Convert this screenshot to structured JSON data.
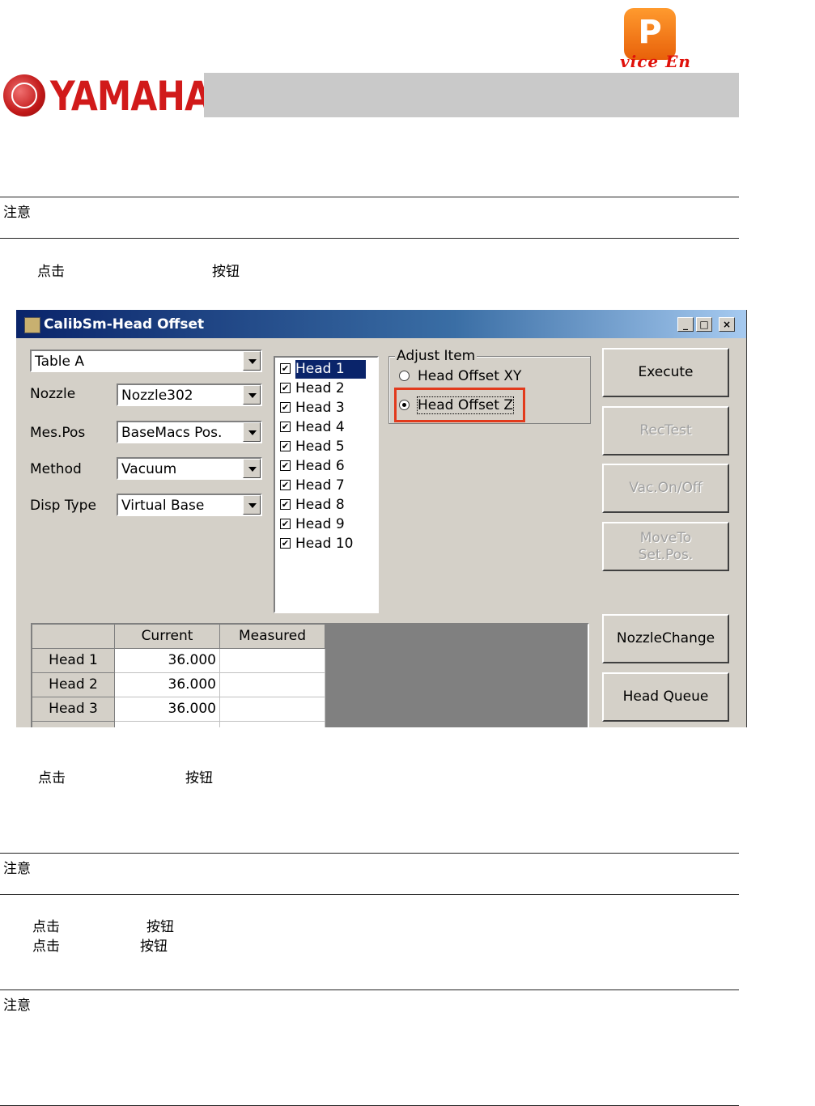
{
  "header": {
    "badge_letter": "P",
    "logo_text": "vice  En",
    "brand": "YAMAHA"
  },
  "doc": {
    "note1": "注意",
    "step1_a": "点击",
    "step1_b": "按钮",
    "step2_a": "点击",
    "step2_b": "按钮",
    "note2": "注意",
    "step3_a": "点击",
    "step3_b": "按钮",
    "step4_a": "点击",
    "step4_b": "按钮",
    "note3": "注意"
  },
  "window": {
    "title": "CalibSm-Head Offset",
    "caption_buttons": [
      "_",
      "□",
      "×"
    ],
    "table_select": "Table A",
    "fields": [
      {
        "label": "Nozzle",
        "value": "Nozzle302"
      },
      {
        "label": "Mes.Pos",
        "value": "BaseMacs Pos."
      },
      {
        "label": "Method",
        "value": "Vacuum"
      },
      {
        "label": "Disp Type",
        "value": "Virtual Base"
      }
    ],
    "heads": [
      {
        "label": "Head 1",
        "checked": true,
        "selected": true
      },
      {
        "label": "Head 2",
        "checked": true
      },
      {
        "label": "Head 3",
        "checked": true
      },
      {
        "label": "Head 4",
        "checked": true
      },
      {
        "label": "Head 5",
        "checked": true
      },
      {
        "label": "Head 6",
        "checked": true
      },
      {
        "label": "Head 7",
        "checked": true
      },
      {
        "label": "Head 8",
        "checked": true
      },
      {
        "label": "Head 9",
        "checked": true
      },
      {
        "label": "Head 10",
        "checked": true
      }
    ],
    "check_glyph": "✔",
    "adjust": {
      "title": "Adjust Item",
      "options": [
        {
          "label": "Head Offset XY",
          "selected": false
        },
        {
          "label": "Head Offset Z",
          "selected": true
        }
      ]
    },
    "buttons": [
      {
        "label": "Execute",
        "enabled": true
      },
      {
        "label": "RecTest",
        "enabled": false
      },
      {
        "label": "Vac.On/Off",
        "enabled": false
      },
      {
        "label": "MoveTo\nSet.Pos.",
        "enabled": false
      },
      {
        "label": "NozzleChange",
        "enabled": true
      },
      {
        "label": "Head Queue",
        "enabled": true
      }
    ],
    "table": {
      "columns": [
        "",
        "Current",
        "Measured"
      ],
      "rows": [
        {
          "head": "Head 1",
          "current": "36.000",
          "measured": ""
        },
        {
          "head": "Head 2",
          "current": "36.000",
          "measured": ""
        },
        {
          "head": "Head 3",
          "current": "36.000",
          "measured": ""
        }
      ]
    },
    "colors": {
      "highlight": "#e23a1c",
      "title_bar": "#0a246a",
      "selection": "#0a246a"
    }
  }
}
